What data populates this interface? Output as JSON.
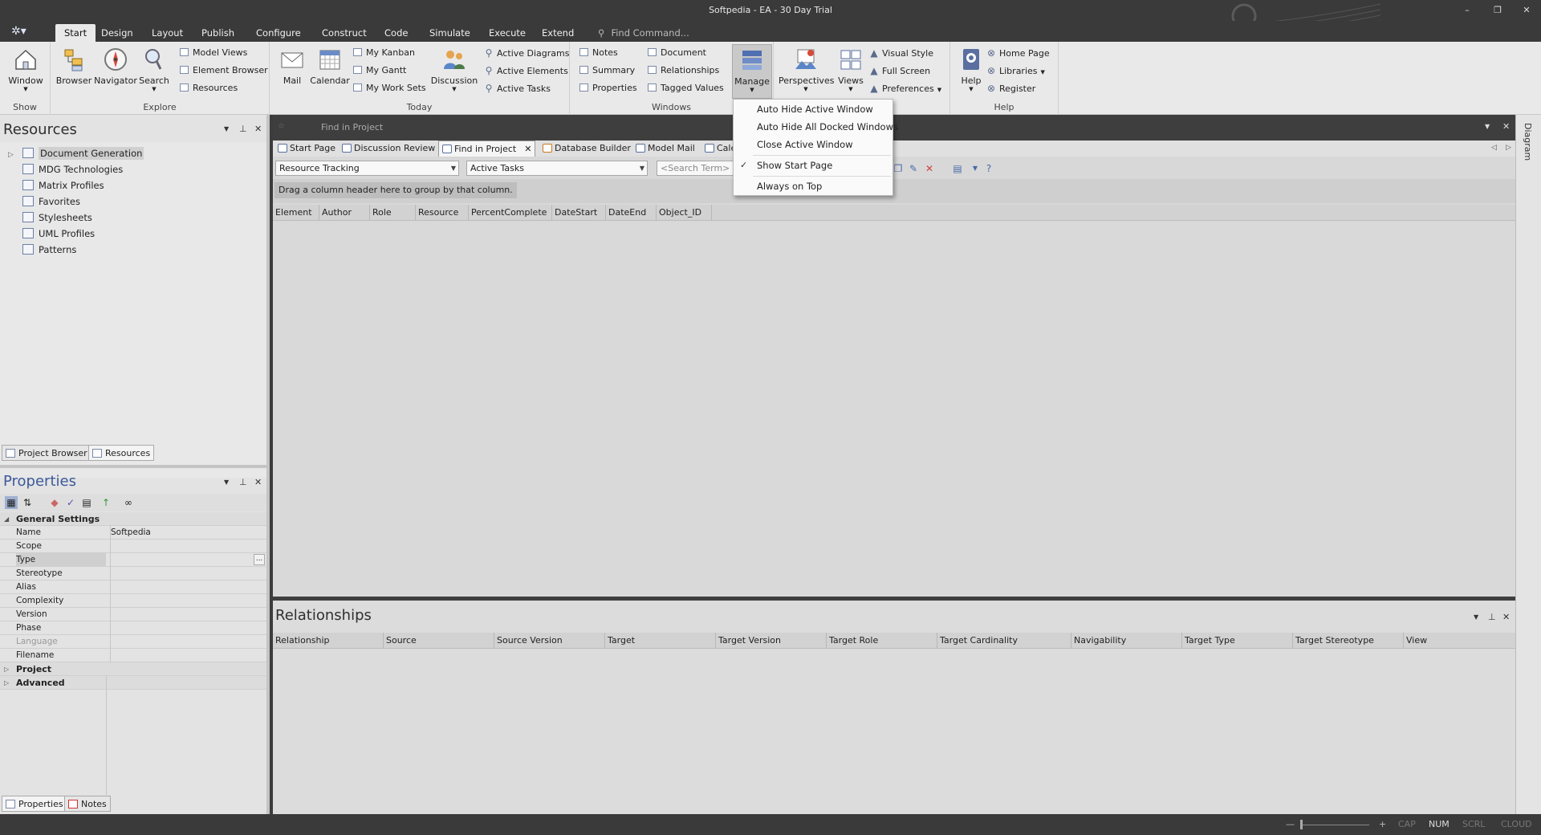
{
  "window": {
    "title": "Softpedia - EA - 30 Day Trial",
    "minimize": "–",
    "restore": "❐",
    "close": "✕"
  },
  "app_button": "✲▾",
  "menu": {
    "tabs": [
      "Start",
      "Design",
      "Layout",
      "Publish",
      "Configure",
      "Construct",
      "Code",
      "Simulate",
      "Execute",
      "Extend"
    ],
    "active": "Start",
    "find_command": "Find Command..."
  },
  "ribbon": {
    "show": {
      "label": "Show",
      "window": "Window"
    },
    "explore": {
      "label": "Explore",
      "browser": "Browser",
      "navigator": "Navigator",
      "search": "Search",
      "items": [
        "Model Views",
        "Element Browser",
        "Resources"
      ]
    },
    "today": {
      "label": "Today",
      "mail": "Mail",
      "calendar": "Calendar",
      "items": [
        "My Kanban",
        "My Gantt",
        "My Work Sets"
      ],
      "discussion": "Discussion",
      "active_items": [
        "Active Diagrams",
        "Active Elements",
        "Active Tasks"
      ]
    },
    "windows": {
      "label": "Windows",
      "items_a": [
        "Notes",
        "Summary",
        "Properties"
      ],
      "items_b": [
        "Document",
        "Relationships",
        "Tagged Values"
      ],
      "manage": "Manage"
    },
    "workspace": {
      "perspectives": "Perspectives",
      "views": "Views",
      "items": [
        "Visual Style",
        "Full Screen",
        "Preferences"
      ]
    },
    "help": {
      "label": "Help",
      "help": "Help",
      "items": [
        "Home Page",
        "Libraries",
        "Register"
      ]
    }
  },
  "resources_panel": {
    "title": "Resources",
    "tree": [
      "Document Generation",
      "MDG Technologies",
      "Matrix Profiles",
      "Favorites",
      "Stylesheets",
      "UML Profiles",
      "Patterns"
    ],
    "tabs": [
      "Project Browser",
      "Resources"
    ]
  },
  "properties_panel": {
    "title": "Properties",
    "groups": {
      "general": "General Settings",
      "project": "Project",
      "advanced": "Advanced"
    },
    "rows": [
      {
        "key": "Name",
        "value": "Softpedia"
      },
      {
        "key": "Scope",
        "value": ""
      },
      {
        "key": "Type",
        "value": ""
      },
      {
        "key": "Stereotype",
        "value": ""
      },
      {
        "key": "Alias",
        "value": ""
      },
      {
        "key": "Complexity",
        "value": ""
      },
      {
        "key": "Version",
        "value": ""
      },
      {
        "key": "Phase",
        "value": ""
      },
      {
        "key": "Language",
        "value": ""
      },
      {
        "key": "Filename",
        "value": ""
      }
    ],
    "ellipsis": "...",
    "tabs": [
      "Properties",
      "Notes"
    ]
  },
  "document": {
    "header_title": "Find in Project",
    "tabs": [
      "Start Page",
      "Discussion Review",
      "Find in Project",
      "Database Builder",
      "Model Mail",
      "Cale"
    ],
    "active_tab": "Find in Project",
    "combo_search_type": "Resource Tracking",
    "combo_search": "Active Tasks",
    "search_placeholder": "<Search Term>",
    "group_hint": "Drag a column header here to group by that column.",
    "columns": [
      "Element",
      "Author",
      "Role",
      "Resource",
      "PercentComplete",
      "DateStart",
      "DateEnd",
      "Object_ID"
    ]
  },
  "relationships_panel": {
    "title": "Relationships",
    "columns": [
      "Relationship",
      "Source",
      "Source Version",
      "Target",
      "Target Version",
      "Target Role",
      "Target Cardinality",
      "Navigability",
      "Target Type",
      "Target Stereotype",
      "View"
    ]
  },
  "right_strip": {
    "label": "Diagram"
  },
  "manage_menu": {
    "items": [
      "Auto Hide Active Window",
      "Auto Hide All Docked Windows",
      "Close Active Window",
      "Show Start Page",
      "Always on Top"
    ],
    "checked": "Show Start Page"
  },
  "status": {
    "zoom_minus": "—",
    "zoom_plus": "+",
    "cap": "CAP",
    "num": "NUM",
    "scrl": "SCRL",
    "cloud": "CLOUD"
  },
  "colors": {
    "chrome": "#3a3a3a",
    "ribbon": "#e9e9e9",
    "panel": "#e3e3e3",
    "accent": "#5a6fa0"
  }
}
